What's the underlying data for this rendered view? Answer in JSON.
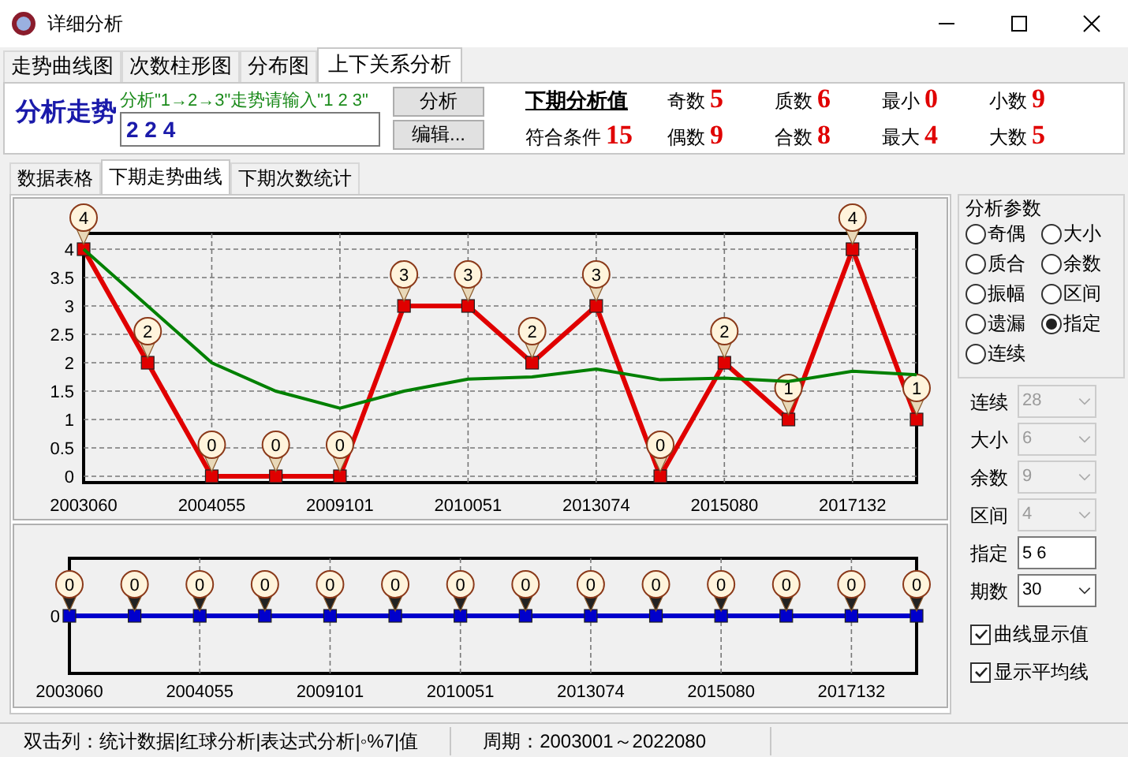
{
  "window": {
    "title": "详细分析"
  },
  "tabs": [
    {
      "label": "走势曲线图",
      "selected": false
    },
    {
      "label": "次数柱形图",
      "selected": false
    },
    {
      "label": "分布图",
      "selected": false
    },
    {
      "label": "上下关系分析",
      "selected": true
    }
  ],
  "analysis": {
    "heading": "分析走势",
    "hint": "分析\"1→2→3\"走势请输入\"1 2 3\"",
    "value": "2 2 4",
    "buttons": [
      "分析",
      "编辑..."
    ]
  },
  "summary_heading": "下期分析值",
  "summary": [
    {
      "label": "符合条件",
      "value": "15"
    },
    {
      "label": "奇数",
      "value": "5"
    },
    {
      "label": "偶数",
      "value": "9"
    },
    {
      "label": "质数",
      "value": "6"
    },
    {
      "label": "合数",
      "value": "8"
    },
    {
      "label": "最小",
      "value": "0"
    },
    {
      "label": "最大",
      "value": "4"
    },
    {
      "label": "小数",
      "value": "9"
    },
    {
      "label": "大数",
      "value": "5"
    }
  ],
  "sub_tabs": [
    {
      "label": "数据表格",
      "selected": false
    },
    {
      "label": "下期走势曲线",
      "selected": true
    },
    {
      "label": "下期次数统计",
      "selected": false
    }
  ],
  "charts": [
    {
      "chart_data": {
        "type": "line",
        "categories": [
          "2003060",
          null,
          "2004055",
          null,
          "2009101",
          null,
          "2010051",
          null,
          "2013074",
          null,
          "2015080",
          null,
          "2017132",
          null
        ],
        "ylim": [
          0,
          4
        ],
        "yticks": [
          0,
          0.5,
          1,
          1.5,
          2,
          2.5,
          3,
          3.5,
          4
        ],
        "series": [
          {
            "color": "#e00000",
            "marker": "square",
            "values": [
              4,
              2,
              0,
              0,
              0,
              3,
              3,
              2,
              3,
              0,
              2,
              1,
              4,
              1
            ],
            "value_labels": [
              "4",
              "2",
              "0",
              "0",
              "0",
              "3",
              "3",
              "2",
              "3",
              "0",
              "2",
              "1",
              "4",
              "1"
            ]
          },
          {
            "color": "#008000",
            "values": [
              4,
              3,
              2,
              1.5,
              1.2,
              1.5,
              1.71,
              1.75,
              1.89,
              1.7,
              1.73,
              1.67,
              1.85,
              1.79
            ]
          }
        ],
        "grid": true
      }
    },
    {
      "kind": "strip",
      "axis_label": "0",
      "x_labels": [
        "2003060",
        "2004055",
        "2009101",
        "2010051",
        "2013074",
        "2015080",
        "2017132"
      ],
      "point_labels": [
        "0",
        "0",
        "0",
        "0",
        "0",
        "0",
        "0",
        "0",
        "0",
        "0",
        "0",
        "0",
        "0",
        "0"
      ]
    }
  ],
  "params": {
    "title": "分析参数",
    "radios": [
      {
        "label": "奇偶",
        "selected": false
      },
      {
        "label": "大小",
        "selected": false
      },
      {
        "label": "质合",
        "selected": false
      },
      {
        "label": "余数",
        "selected": false
      },
      {
        "label": "振幅",
        "selected": false
      },
      {
        "label": "区间",
        "selected": false
      },
      {
        "label": "遗漏",
        "selected": false
      },
      {
        "label": "指定",
        "selected": true
      },
      {
        "label": "连续",
        "selected": false
      }
    ]
  },
  "fields": [
    {
      "label": "连续",
      "value": "28",
      "kind": "combo",
      "disabled": true
    },
    {
      "label": "大小",
      "value": "6",
      "kind": "combo",
      "disabled": true
    },
    {
      "label": "余数",
      "value": "9",
      "kind": "combo",
      "disabled": true
    },
    {
      "label": "区间",
      "value": "4",
      "kind": "combo",
      "disabled": true
    },
    {
      "label": "指定",
      "value": "5 6",
      "kind": "text",
      "disabled": false
    },
    {
      "label": "期数",
      "value": "30",
      "kind": "combo",
      "disabled": false
    }
  ],
  "checkboxes": [
    {
      "label": "曲线显示值",
      "checked": true
    },
    {
      "label": "显示平均线",
      "checked": true
    }
  ],
  "status_bar": [
    "双击列：统计数据|红球分析|表达式分析|◦%7|值",
    "周期：2003001～2022080"
  ]
}
